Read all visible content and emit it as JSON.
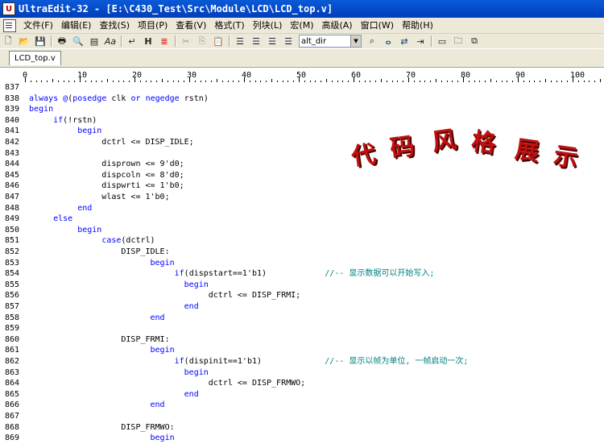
{
  "window": {
    "title": "UltraEdit-32 - [E:\\C430_Test\\Src\\Module\\LCD\\LCD_top.v]"
  },
  "menu": [
    "文件(F)",
    "编辑(E)",
    "查找(S)",
    "项目(P)",
    "查看(V)",
    "格式(T)",
    "列块(L)",
    "宏(M)",
    "高级(A)",
    "窗口(W)",
    "帮助(H)"
  ],
  "toolbar": {
    "combo_value": "alt_dir",
    "icons": [
      "new-file-icon",
      "open-folder-icon",
      "save-icon",
      "print-icon",
      "print-preview-icon",
      "find-icon",
      "toggle-column-icon",
      "font-icon",
      "word-wrap-icon",
      "hex-mode-icon",
      "line-numbers-icon",
      "cut-icon",
      "copy-icon",
      "paste-icon",
      "align-left-icon",
      "align-center-icon",
      "align-right-icon",
      "justify-icon",
      "binoculars-icon",
      "find-in-files-icon",
      "replace-in-files-icon",
      "goto-icon",
      "window-icon",
      "folder-window-icon",
      "tile-icon"
    ]
  },
  "tabs": [
    "LCD_top.v"
  ],
  "ruler": {
    "labels": [
      "0",
      "10",
      "20",
      "30",
      "40",
      "50",
      "60",
      "70",
      "80",
      "90",
      "100"
    ]
  },
  "watermark": [
    "代",
    "码",
    "风",
    "格",
    "展",
    "示"
  ],
  "code_lines": [
    {
      "n": "837",
      "t": ""
    },
    {
      "n": "838",
      "t": "always @(posedge clk or negedge rstn)"
    },
    {
      "n": "839",
      "t": "begin"
    },
    {
      "n": "840",
      "t": "     if(!rstn)"
    },
    {
      "n": "841",
      "t": "          begin"
    },
    {
      "n": "842",
      "t": "               dctrl <= DISP_IDLE;"
    },
    {
      "n": "843",
      "t": ""
    },
    {
      "n": "844",
      "t": "               disprown <= 9'd0;"
    },
    {
      "n": "845",
      "t": "               dispcoln <= 8'd0;"
    },
    {
      "n": "846",
      "t": "               dispwrti <= 1'b0;"
    },
    {
      "n": "847",
      "t": "               wlast <= 1'b0;"
    },
    {
      "n": "848",
      "t": "          end"
    },
    {
      "n": "849",
      "t": "     else"
    },
    {
      "n": "850",
      "t": "          begin"
    },
    {
      "n": "851",
      "t": "               case(dctrl)"
    },
    {
      "n": "852",
      "t": "                   DISP_IDLE:"
    },
    {
      "n": "853",
      "t": "                         begin"
    },
    {
      "n": "854",
      "t": "                              if(dispstart==1'b1)            //-- 显示数据可以开始写入;"
    },
    {
      "n": "855",
      "t": "                                begin"
    },
    {
      "n": "856",
      "t": "                                     dctrl <= DISP_FRMI;"
    },
    {
      "n": "857",
      "t": "                                end"
    },
    {
      "n": "858",
      "t": "                         end"
    },
    {
      "n": "859",
      "t": ""
    },
    {
      "n": "860",
      "t": "                   DISP_FRMI:"
    },
    {
      "n": "861",
      "t": "                         begin"
    },
    {
      "n": "862",
      "t": "                              if(dispinit==1'b1)             //-- 显示以帧为单位, 一帧启动一次;"
    },
    {
      "n": "863",
      "t": "                                begin"
    },
    {
      "n": "864",
      "t": "                                     dctrl <= DISP_FRMWO;"
    },
    {
      "n": "865",
      "t": "                                end"
    },
    {
      "n": "866",
      "t": "                         end"
    },
    {
      "n": "867",
      "t": ""
    },
    {
      "n": "868",
      "t": "                   DISP_FRMWO:"
    },
    {
      "n": "869",
      "t": "                         begin"
    }
  ]
}
